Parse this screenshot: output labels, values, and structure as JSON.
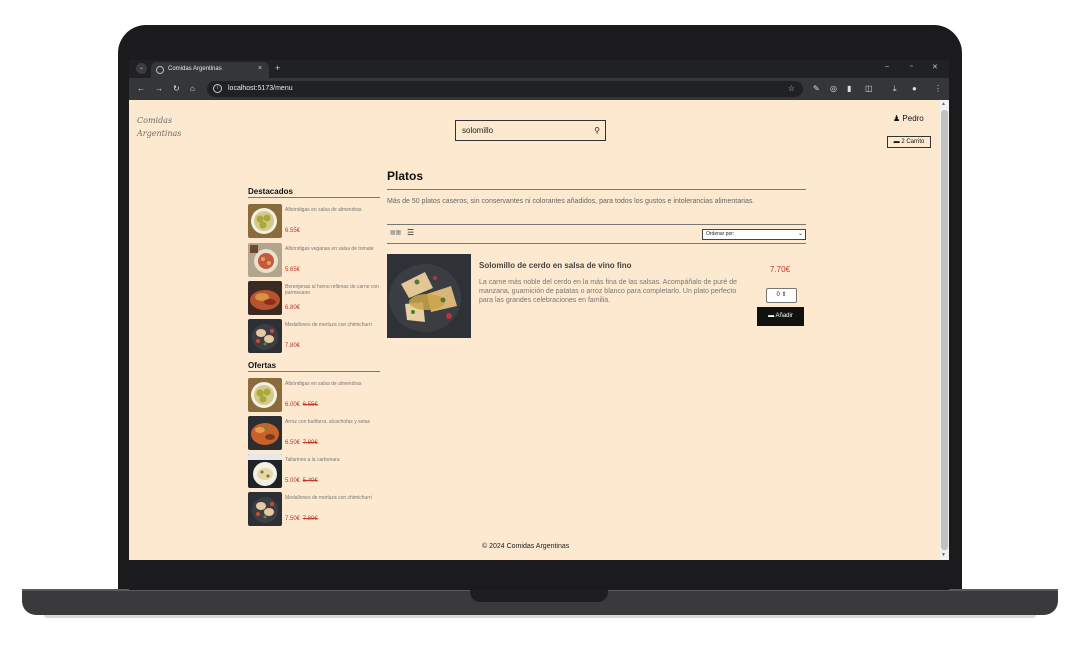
{
  "browser": {
    "tab_title": "Comidas Argentinas",
    "tab_close": "×",
    "new_tab": "+",
    "url": "localhost:5173/menu",
    "win_min": "–",
    "win_restore": "▫",
    "win_close": "✕"
  },
  "header": {
    "logo_line1": "Comidas",
    "logo_line2": "Argentinas",
    "search_value": "solomillo",
    "user_name": "Pedro",
    "cart_label": "2 Carrito"
  },
  "sidebar": {
    "featured_title": "Destacados",
    "featured": [
      {
        "name": "Albóndigas en salsa de almendras",
        "price": "6.55€"
      },
      {
        "name": "Albóndigas veganas en salsa de tomate",
        "price": "5.65€"
      },
      {
        "name": "Berenjenas al horno rellenas de carne con parmesano",
        "price": "6.80€"
      },
      {
        "name": "Medallones de merluza con chimichurri",
        "price": "7.80€"
      }
    ],
    "offers_title": "Ofertas",
    "offers": [
      {
        "name": "Albóndigas en salsa de almendras",
        "price": "6.00€",
        "old_price": "6.55€"
      },
      {
        "name": "Arroz con butifarra, alcachofas y setas",
        "price": "6.50€",
        "old_price": "7.80€"
      },
      {
        "name": "Tallarines a la carbonara",
        "price": "5.00€",
        "old_price": "5.40€"
      },
      {
        "name": "Medallones de merluza con chimichurri",
        "price": "7.50€",
        "old_price": "7.80€"
      }
    ]
  },
  "main": {
    "title": "Platos",
    "description": "Más de 50 platos caseros, sin conservantes ni colorantes añadidos, para todos los gustos e intolerancias alimentarias.",
    "sort_label": "Ordenar por:",
    "product": {
      "name": "Solomillo de cerdo en salsa de vino fino",
      "description": "La carne más noble del cerdo en la más fina de las salsas. Acompáñalo de puré de manzana, guarnición de patatas o arroz blanco para completarlo. Un plato perfecto para las grandes celebraciones en familia.",
      "price": "7.70€",
      "quantity": "0",
      "add_label": "Añadir"
    }
  },
  "footer": {
    "text": "© 2024 Comidas Argentinas"
  }
}
